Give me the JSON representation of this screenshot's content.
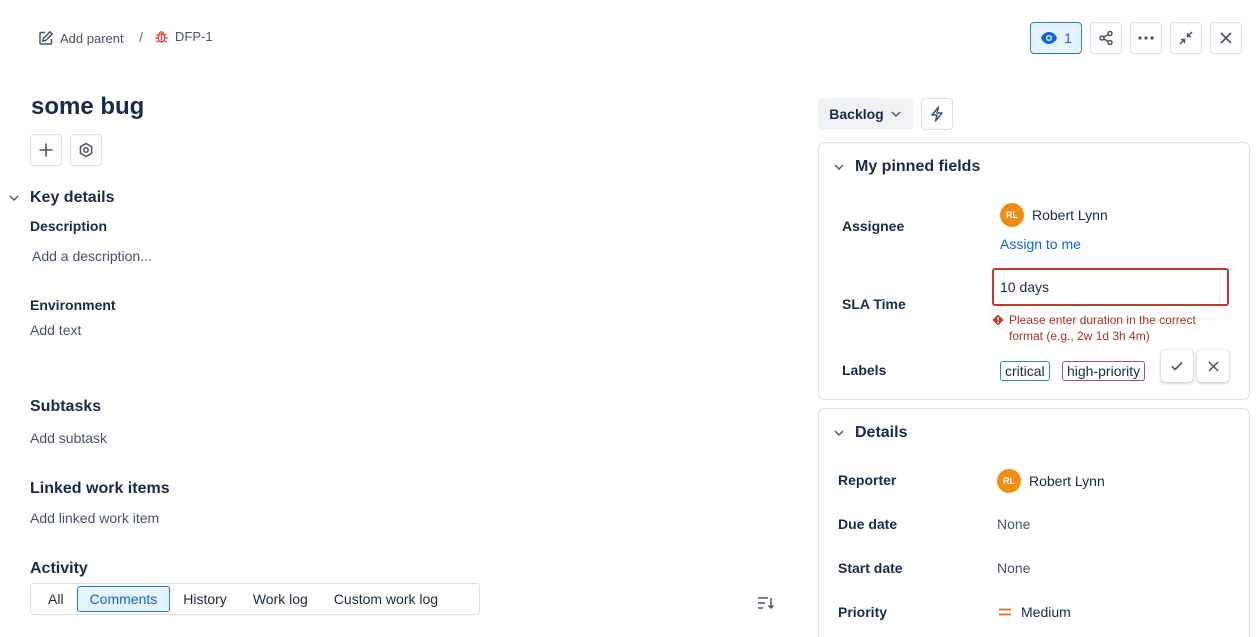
{
  "breadcrumb": {
    "add_parent": "Add parent",
    "separator": "/",
    "issue_key": "DFP-1"
  },
  "toolbar": {
    "watch_count": "1"
  },
  "issue": {
    "title": "some bug"
  },
  "key_details": {
    "heading": "Key details",
    "description_label": "Description",
    "description_placeholder": "Add a description...",
    "environment_label": "Environment",
    "environment_placeholder": "Add text"
  },
  "subtasks": {
    "heading": "Subtasks",
    "placeholder": "Add subtask"
  },
  "linked": {
    "heading": "Linked work items",
    "placeholder": "Add linked work item"
  },
  "activity": {
    "heading": "Activity",
    "tabs": [
      "All",
      "Comments",
      "History",
      "Work log",
      "Custom work log"
    ],
    "active_tab": "Comments"
  },
  "status": {
    "label": "Backlog"
  },
  "pinned": {
    "heading": "My pinned fields",
    "assignee_label": "Assignee",
    "assignee_initials": "RL",
    "assignee_name": "Robert Lynn",
    "assign_to_me": "Assign to me",
    "sla_label": "SLA Time",
    "sla_value": "10 days",
    "sla_error": "Please enter duration in the correct format (e.g., 2w 1d 3h 4m)",
    "labels_label": "Labels",
    "labels": [
      "critical",
      "high-priority"
    ]
  },
  "details": {
    "heading": "Details",
    "reporter_label": "Reporter",
    "reporter_initials": "RL",
    "reporter_name": "Robert Lynn",
    "due_label": "Due date",
    "due_value": "None",
    "start_label": "Start date",
    "start_value": "None",
    "priority_label": "Priority",
    "priority_value": "Medium"
  },
  "colors": {
    "accent": "#0c66e4",
    "error": "#c9372c",
    "avatar": "#f18d13",
    "bug": "#e2483d",
    "priority_medium": "#e56910"
  }
}
